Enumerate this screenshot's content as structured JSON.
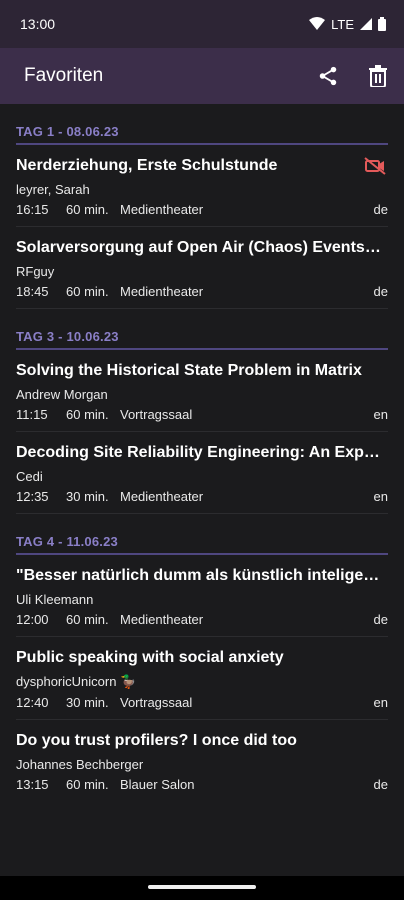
{
  "status_bar": {
    "time": "13:00",
    "network": "LTE"
  },
  "app_bar": {
    "title": "Favoriten",
    "share_icon": "share-icon",
    "delete_icon": "trash-icon"
  },
  "days": [
    {
      "label": "TAG 1 - 08.06.23",
      "events": [
        {
          "title": "Nerderziehung, Erste Schulstunde",
          "speaker": "leyrer, Sarah",
          "start": "16:15",
          "duration": "60 min.",
          "room": "Medientheater",
          "lang": "de",
          "no_video": true
        },
        {
          "title": "Solarversorgung auf Open Air (Chaos) Events und …",
          "speaker": "RFguy",
          "start": "18:45",
          "duration": "60 min.",
          "room": "Medientheater",
          "lang": "de",
          "no_video": false
        }
      ]
    },
    {
      "label": "TAG 3 - 10.06.23",
      "events": [
        {
          "title": "Solving the Historical State Problem in Matrix",
          "speaker": "Andrew Morgan",
          "start": "11:15",
          "duration": "60 min.",
          "room": "Vortragssaal",
          "lang": "en",
          "no_video": false
        },
        {
          "title": "Decoding Site Reliability Engineering: An Explorati…",
          "speaker": "Cedi",
          "start": "12:35",
          "duration": "30 min.",
          "room": "Medientheater",
          "lang": "en",
          "no_video": false
        }
      ]
    },
    {
      "label": "TAG 4 - 11.06.23",
      "events": [
        {
          "title": "\"Besser natürlich dumm als künstlich inteligent.\" W…",
          "speaker": "Uli Kleemann",
          "start": "12:00",
          "duration": "60 min.",
          "room": "Medientheater",
          "lang": "de",
          "no_video": false
        },
        {
          "title": "Public speaking with social anxiety",
          "speaker": "dysphoricUnicorn 🦆",
          "start": "12:40",
          "duration": "30 min.",
          "room": "Vortragssaal",
          "lang": "en",
          "no_video": false
        },
        {
          "title": "Do you trust profilers? I once did too",
          "speaker": "Johannes Bechberger",
          "start": "13:15",
          "duration": "60 min.",
          "room": "Blauer Salon",
          "lang": "de",
          "no_video": false
        }
      ]
    }
  ],
  "colors": {
    "accent": "#8a7fc7",
    "app_bar": "#3c2e4a",
    "background": "#1b1b1d",
    "no_video_icon": "#e35a5a"
  }
}
